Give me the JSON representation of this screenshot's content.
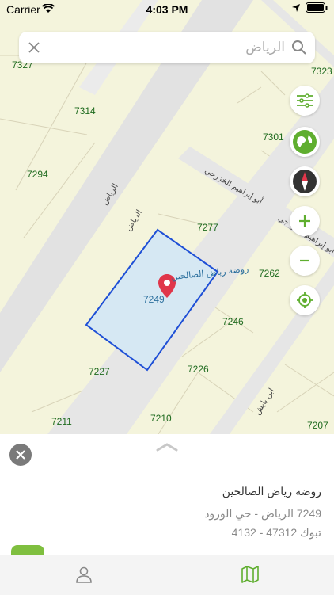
{
  "status_bar": {
    "carrier": "Carrier",
    "time": "4:03 PM"
  },
  "search": {
    "placeholder": "الرياض"
  },
  "map": {
    "parcel_numbers": [
      "7327",
      "7323",
      "7314",
      "7301",
      "7294",
      "7277",
      "7262",
      "7249",
      "7246",
      "7227",
      "7226",
      "7211",
      "7210",
      "7207"
    ],
    "poi_label": "روضة رياض الصالحين",
    "road_labels": [
      "الرياض",
      "الرياض",
      "أبو إبراهيم الخزرجي",
      "أبو إبراهيم الخزرجي",
      "ابن يايش"
    ]
  },
  "controls": [
    "filters-icon",
    "globe-icon",
    "compass-icon",
    "zoom-in-icon",
    "zoom-out-icon",
    "locate-icon"
  ],
  "details": {
    "title": "روضة رياض الصالحين",
    "address": "7249 الرياض - حي الورود",
    "postal": "تبوك 47312 - 4132"
  },
  "tabbar": {
    "tabs": [
      "profile-icon",
      "map-icon"
    ]
  },
  "colors": {
    "accent": "#5fae2f",
    "parcel_stroke": "#1e4fd6",
    "parcel_fill": "#d6e8f3",
    "map_bg": "#f4f4dc",
    "road": "#e6e6e6"
  }
}
